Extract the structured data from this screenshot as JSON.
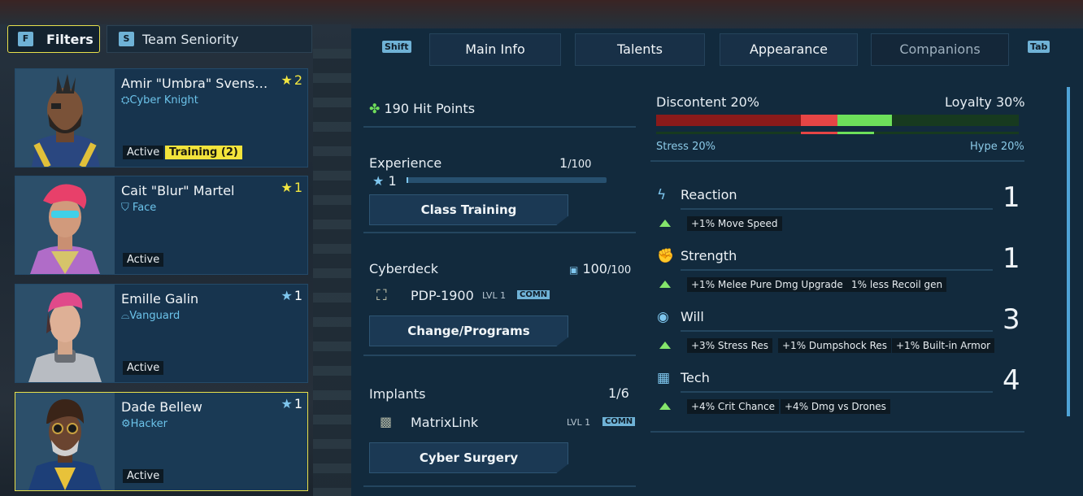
{
  "filters": {
    "key": "F",
    "label": "Filters"
  },
  "sort": {
    "key": "S",
    "label": "Team Seniority"
  },
  "roster": [
    {
      "name": "Amir \"Umbra\" Svens…",
      "class": "Cyber Knight",
      "rank": "2",
      "status": "Active",
      "training": "Training (2)"
    },
    {
      "name": "Cait \"Blur\" Martel",
      "class": "Face",
      "rank": "1",
      "status": "Active"
    },
    {
      "name": "Emille Galin",
      "class": "Vanguard",
      "rank": "1",
      "status": "Active"
    },
    {
      "name": "Dade Bellew",
      "class": "Hacker",
      "rank": "1",
      "status": "Active"
    }
  ],
  "tabs": {
    "prev_key": "Shift",
    "next_key": "Tab",
    "items": [
      "Main Info",
      "Talents",
      "Appearance",
      "Companions"
    ]
  },
  "main": {
    "hit_points": "190 Hit Points",
    "experience": {
      "label": "Experience",
      "value": "1",
      "max": "/100",
      "level": "1",
      "progress": 0.01
    },
    "class_training": "Class Training",
    "cyberdeck": {
      "label": "Cyberdeck",
      "capacity": "100",
      "capacity_max": "/100",
      "item": "PDP-1900",
      "item_level": "LVL 1",
      "rarity": "COMN",
      "button": "Change/Programs"
    },
    "implants": {
      "label": "Implants",
      "count": "1/6",
      "item": "MatrixLink",
      "item_level": "LVL 1",
      "rarity": "COMN",
      "button": "Cyber Surgery"
    }
  },
  "mood": {
    "discontent": "Discontent 20%",
    "loyalty": "Loyalty 30%",
    "stress": "Stress 20%",
    "hype": "Hype 20%",
    "colors": {
      "discontent": "#8a1a1a",
      "stress": "#e64545",
      "loyalty": "#6de05a",
      "hype": "#2f5a2a"
    }
  },
  "stats": [
    {
      "name": "Reaction",
      "value": "1",
      "bonuses": [
        "+1% Move Speed"
      ],
      "icon": "lightning-icon"
    },
    {
      "name": "Strength",
      "value": "1",
      "bonuses": [
        "+1% Melee Pure Dmg Upgrade",
        "1% less Recoil gen"
      ],
      "icon": "arm-icon"
    },
    {
      "name": "Will",
      "value": "3",
      "bonuses": [
        "+3% Stress Res",
        "+1% Dumpshock Res",
        "+1% Built-in Armor"
      ],
      "icon": "mind-icon"
    },
    {
      "name": "Tech",
      "value": "4",
      "bonuses": [
        "+4% Crit Chance",
        "+4% Dmg vs Drones"
      ],
      "icon": "chip-icon"
    }
  ]
}
